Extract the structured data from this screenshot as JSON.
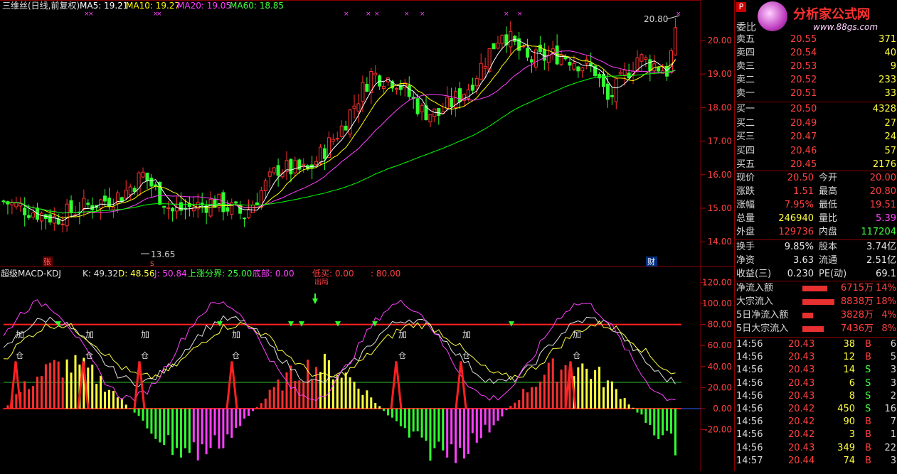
{
  "main_header": {
    "title": "三维丝(日线,前复权)",
    "ma5": "MA5: 19.21",
    "ma10": "MA10: 19.27",
    "ma20": "MA20: 19.05",
    "ma60": "MA60: 18.85",
    "colors": {
      "ma5": "#ffffff",
      "ma10": "#ffff00",
      "ma20": "#ff40ff",
      "ma60": "#00ff00"
    }
  },
  "price_axis": [
    "20.00",
    "19.00",
    "18.00",
    "17.00",
    "16.00",
    "15.00",
    "14.00"
  ],
  "main_annotations": {
    "high_label": "20.80",
    "low_label": "13.65",
    "zhang_label": "张",
    "cai_label": "财",
    "s_label": "S"
  },
  "sub_header": {
    "title": "超级MACD-KDJ",
    "k": "K: 49.32",
    "d": "D: 48.56",
    "j": "J: 50.84",
    "up_boundary": "上涨分界: 25.00",
    "bottom": "底部: 0.00",
    "low_buy": "低买: 0.00",
    "eighty": ": 80.00",
    "chu_label": "出局"
  },
  "sub_axis": [
    "120.00",
    "100.00",
    "80.00",
    "60.00",
    "40.00",
    "20.00",
    "0.00",
    "-20.00"
  ],
  "sub_labels": {
    "jia": "加",
    "cang": "仓"
  },
  "logo": {
    "text": "分析家公式网",
    "url": "www.88gs.com"
  },
  "quote": {
    "top_label": "委比",
    "sell": [
      {
        "label": "卖五",
        "price": "20.55",
        "vol": "371"
      },
      {
        "label": "卖四",
        "price": "20.54",
        "vol": "40"
      },
      {
        "label": "卖三",
        "price": "20.53",
        "vol": "9"
      },
      {
        "label": "卖二",
        "price": "20.52",
        "vol": "233"
      },
      {
        "label": "卖一",
        "price": "20.51",
        "vol": "33"
      }
    ],
    "buy": [
      {
        "label": "买一",
        "price": "20.50",
        "vol": "4328"
      },
      {
        "label": "买二",
        "price": "20.49",
        "vol": "27"
      },
      {
        "label": "买三",
        "price": "20.47",
        "vol": "24"
      },
      {
        "label": "买四",
        "price": "20.46",
        "vol": "57"
      },
      {
        "label": "买五",
        "price": "20.45",
        "vol": "2176"
      }
    ],
    "stats": [
      {
        "l1": "现价",
        "v1": "20.50",
        "l2": "今开",
        "v2": "20.00",
        "c1": "red",
        "c2": "red"
      },
      {
        "l1": "涨跌",
        "v1": "1.51",
        "l2": "最高",
        "v2": "20.80",
        "c1": "red",
        "c2": "red"
      },
      {
        "l1": "涨幅",
        "v1": "7.95%",
        "l2": "最低",
        "v2": "19.51",
        "c1": "red",
        "c2": "red"
      },
      {
        "l1": "总量",
        "v1": "246940",
        "l2": "量比",
        "v2": "5.39",
        "c1": "yellow",
        "c2": "magenta"
      },
      {
        "l1": "外盘",
        "v1": "129736",
        "l2": "内盘",
        "v2": "117204",
        "c1": "red",
        "c2": "green"
      }
    ],
    "stats2": [
      {
        "l1": "换手",
        "v1": "9.85%",
        "l2": "股本",
        "v2": "3.74亿"
      },
      {
        "l1": "净资",
        "v1": "3.63",
        "l2": "流通",
        "v2": "2.51亿"
      },
      {
        "l1": "收益(三)",
        "v1": "0.230",
        "l2": "PE(动)",
        "v2": "69.1"
      }
    ],
    "flows": [
      {
        "label": "净流入额",
        "value": "6715万",
        "pct": "14%",
        "fill": 0.35
      },
      {
        "label": "大宗流入",
        "value": "8838万",
        "pct": "18%",
        "fill": 0.45
      },
      {
        "label": "5日净流入额",
        "value": "3828万",
        "pct": "4%",
        "fill": 0.15
      },
      {
        "label": "5日大宗流入",
        "value": "7436万",
        "pct": "8%",
        "fill": 0.3
      }
    ],
    "ticks": [
      {
        "time": "14:56",
        "price": "20.43",
        "vol": "38",
        "side": "B",
        "n": "6"
      },
      {
        "time": "14:56",
        "price": "20.43",
        "vol": "12",
        "side": "B",
        "n": "5"
      },
      {
        "time": "14:56",
        "price": "20.43",
        "vol": "14",
        "side": "S",
        "n": "3"
      },
      {
        "time": "14:56",
        "price": "20.43",
        "vol": "6",
        "side": "S",
        "n": "3"
      },
      {
        "time": "14:56",
        "price": "20.43",
        "vol": "8",
        "side": "S",
        "n": "2"
      },
      {
        "time": "14:56",
        "price": "20.42",
        "vol": "450",
        "side": "S",
        "n": "16"
      },
      {
        "time": "14:56",
        "price": "20.42",
        "vol": "90",
        "side": "B",
        "n": "7"
      },
      {
        "time": "14:56",
        "price": "20.42",
        "vol": "3",
        "side": "B",
        "n": "1"
      },
      {
        "time": "14:56",
        "price": "20.43",
        "vol": "349",
        "side": "B",
        "n": "22"
      },
      {
        "time": "14:57",
        "price": "20.44",
        "vol": "74",
        "side": "B",
        "n": "3"
      }
    ]
  }
}
